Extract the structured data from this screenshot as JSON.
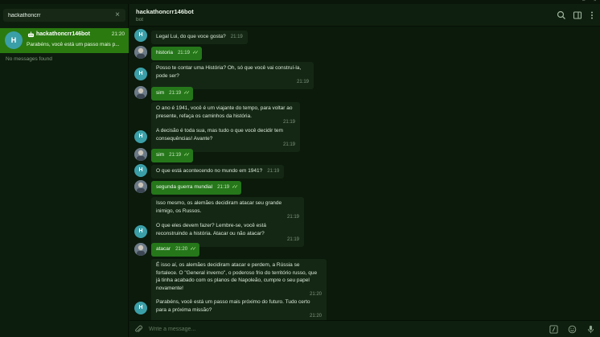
{
  "sidebar": {
    "search": {
      "value": "hackathoncrr",
      "clear_icon": "close-icon"
    },
    "chat": {
      "avatar_letter": "H",
      "name": "hackathoncrr146bot",
      "time": "21:20",
      "preview": "Parabéns, você está um passo mais p...",
      "bot_icon": "bot-icon"
    },
    "no_messages": "No messages found"
  },
  "header": {
    "title": "hackathoncrr146bot",
    "subtitle": "bot",
    "icons": [
      "search-icon",
      "sidebar-toggle-icon",
      "more-vertical-icon"
    ]
  },
  "messages": [
    {
      "from": "bot",
      "text": "Legal Lui, do que voce gosta?",
      "time": "21:19"
    },
    {
      "from": "user",
      "text": "historia",
      "time": "21:19"
    },
    {
      "from": "bot",
      "text": "Posso te contar uma História? Oh, só que você vai construí-la, pode ser?",
      "time": "21:19"
    },
    {
      "from": "user",
      "text": "sim",
      "time": "21:19"
    },
    {
      "from": "bot",
      "text": "O ano é 1941, você é um viajante do tempo, para voltar ao presente, refaça os caminhos da história.",
      "time": "21:19"
    },
    {
      "from": "bot",
      "text": "A decisão é toda sua, mas tudo o que você decidir tem consequências! Avante?",
      "time": "21:19"
    },
    {
      "from": "user",
      "text": "sim",
      "time": "21:19"
    },
    {
      "from": "bot",
      "text": "O que está acontecendo no mundo em 1941?",
      "time": "21:19"
    },
    {
      "from": "user",
      "text": "segunda guerra mundial",
      "time": "21:19"
    },
    {
      "from": "bot",
      "text": "Isso mesmo, os alemães decidiram atacar seu grande inimigo, os Russos.",
      "time": "21:19"
    },
    {
      "from": "bot",
      "text": "O que eles devem fazer? Lembre-se, você está reconstruindo a história. Atacar ou não atacar?",
      "time": "21:19"
    },
    {
      "from": "user",
      "text": "atacar",
      "time": "21:20"
    },
    {
      "from": "bot",
      "text": "É isso aí, os alemães decidiram atacar e perdem, a Rússia se fortalece. O \"General inverno\", o poderoso frio do território russo, que já tinha acabado com os planos de Napoleão, cumpre o seu papel novamente!",
      "time": "21:20"
    },
    {
      "from": "bot",
      "text": "Parabéns, você está um passo mais próximo do futuro. Tudo certo para a próxima missão?",
      "time": "21:20"
    }
  ],
  "composer": {
    "placeholder": "Write a message...",
    "icons": [
      "attach-icon",
      "bot-command-icon",
      "emoji-icon",
      "microphone-icon"
    ]
  },
  "colors": {
    "selected_chat": "#2a7a10",
    "outgoing_bubble": "#25771a",
    "incoming_bubble": "#142714",
    "background": "#0b1a0b",
    "bot_avatar": "#3b9fa8"
  }
}
